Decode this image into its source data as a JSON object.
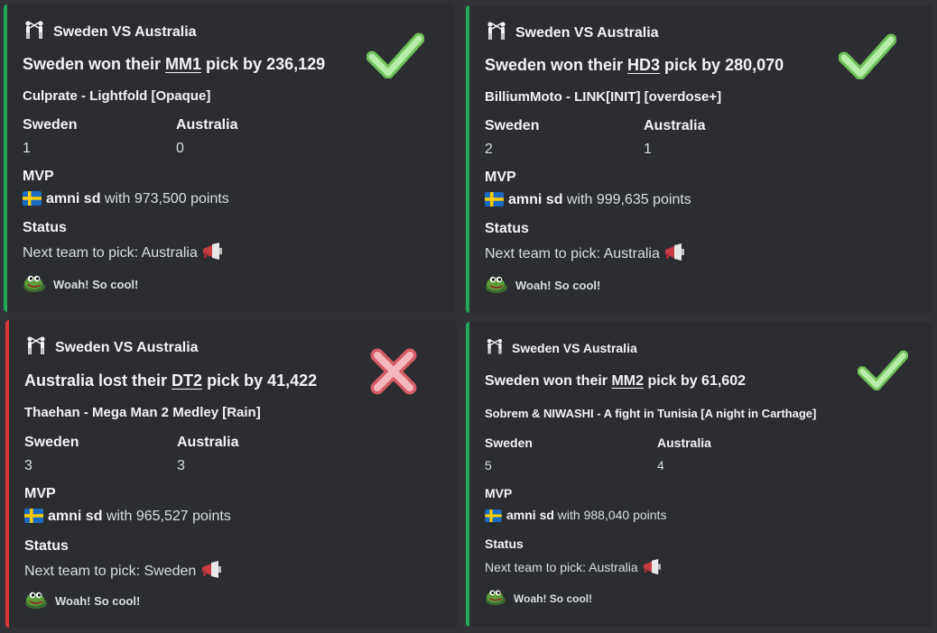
{
  "colors": {
    "win": "#23a55a",
    "loss": "#da373c"
  },
  "cards": [
    {
      "result": "win",
      "header": "Sweden VS Australia",
      "title_pre": "Sweden won their ",
      "title_pick": "MM1",
      "title_post": " pick by 236,129",
      "map": "Culprate - Lightfold [Opaque]",
      "team1": "Sweden",
      "score1": "1",
      "team2": "Australia",
      "score2": "0",
      "mvp_label": "MVP",
      "mvp_name": "amni sd",
      "mvp_points": "with 973,500 points",
      "status_label": "Status",
      "status_text": "Next team to pick: Australia",
      "footer": "Woah! So cool!",
      "icons": [
        "fencing-icon",
        "check-icon",
        "sweden-flag-icon",
        "megaphone-icon",
        "frog-icon"
      ]
    },
    {
      "result": "win",
      "header": "Sweden VS Australia",
      "title_pre": "Sweden won their ",
      "title_pick": "HD3",
      "title_post": " pick by 280,070",
      "map": "BilliumMoto - LINK[INIT] [overdose+]",
      "team1": "Sweden",
      "score1": "2",
      "team2": "Australia",
      "score2": "1",
      "mvp_label": "MVP",
      "mvp_name": "amni sd",
      "mvp_points": "with 999,635 points",
      "status_label": "Status",
      "status_text": "Next team to pick: Australia",
      "footer": "Woah! So cool!",
      "icons": [
        "fencing-icon",
        "check-icon",
        "sweden-flag-icon",
        "megaphone-icon",
        "frog-icon"
      ]
    },
    {
      "result": "loss",
      "header": "Sweden VS Australia",
      "title_pre": "Australia lost their ",
      "title_pick": "DT2",
      "title_post": " pick by 41,422",
      "map": "Thaehan - Mega Man 2 Medley [Rain]",
      "team1": "Sweden",
      "score1": "3",
      "team2": "Australia",
      "score2": "3",
      "mvp_label": "MVP",
      "mvp_name": "amni sd",
      "mvp_points": "with 965,527 points",
      "status_label": "Status",
      "status_text": "Next team to pick: Sweden",
      "footer": "Woah! So cool!",
      "icons": [
        "fencing-icon",
        "cross-icon",
        "sweden-flag-icon",
        "megaphone-icon",
        "frog-icon"
      ]
    },
    {
      "result": "win",
      "header": "Sweden VS Australia",
      "title_pre": "Sweden won their ",
      "title_pick": "MM2",
      "title_post": " pick by 61,602",
      "map": "Sobrem & NIWASHI - A fight in Tunisia [A night in Carthage]",
      "team1": "Sweden",
      "score1": "5",
      "team2": "Australia",
      "score2": "4",
      "mvp_label": "MVP",
      "mvp_name": "amni sd",
      "mvp_points": "with 988,040 points",
      "status_label": "Status",
      "status_text": "Next team to pick: Australia",
      "footer": "Woah! So cool!",
      "icons": [
        "fencing-icon",
        "check-icon",
        "sweden-flag-icon",
        "megaphone-icon",
        "frog-icon"
      ]
    }
  ]
}
